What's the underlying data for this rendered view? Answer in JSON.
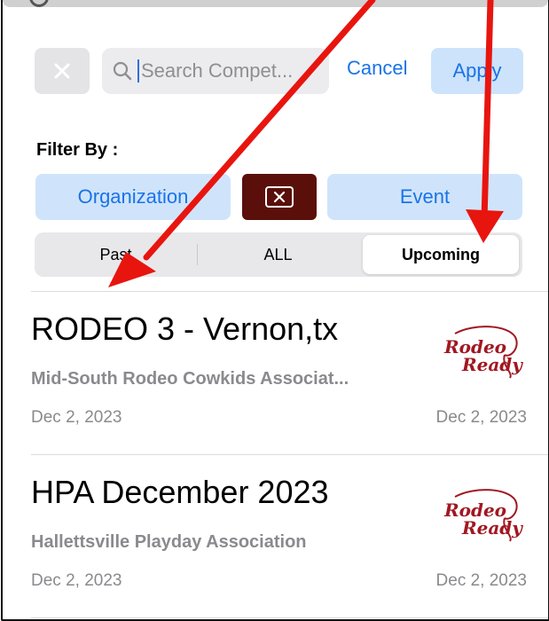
{
  "search": {
    "placeholder": "Search Compet...",
    "cancel_label": "Cancel",
    "apply_label": "Apply"
  },
  "filter": {
    "label": "Filter By :",
    "organization_label": "Organization",
    "event_label": "Event"
  },
  "segments": {
    "past": "Past",
    "all": "ALL",
    "upcoming": "Upcoming",
    "selected": "Upcoming"
  },
  "competitions": [
    {
      "title": "RODEO 3 - Vernon,tx",
      "organization": "Mid-South Rodeo Cowkids Associat...",
      "start_date": "Dec 2, 2023",
      "end_date": "Dec 2, 2023",
      "logo_text": "Rodeo Ready"
    },
    {
      "title": "HPA December 2023",
      "organization": "Hallettsville Playday Association",
      "start_date": "Dec 2, 2023",
      "end_date": "Dec 2, 2023",
      "logo_text": "Rodeo Ready"
    }
  ],
  "colors": {
    "accent": "#1a73e8",
    "chip_bg": "#cfe4fb",
    "clear_filter_bg": "#5a0f0a",
    "annotation_arrow": "#e8150f",
    "logo": "#a01822"
  }
}
